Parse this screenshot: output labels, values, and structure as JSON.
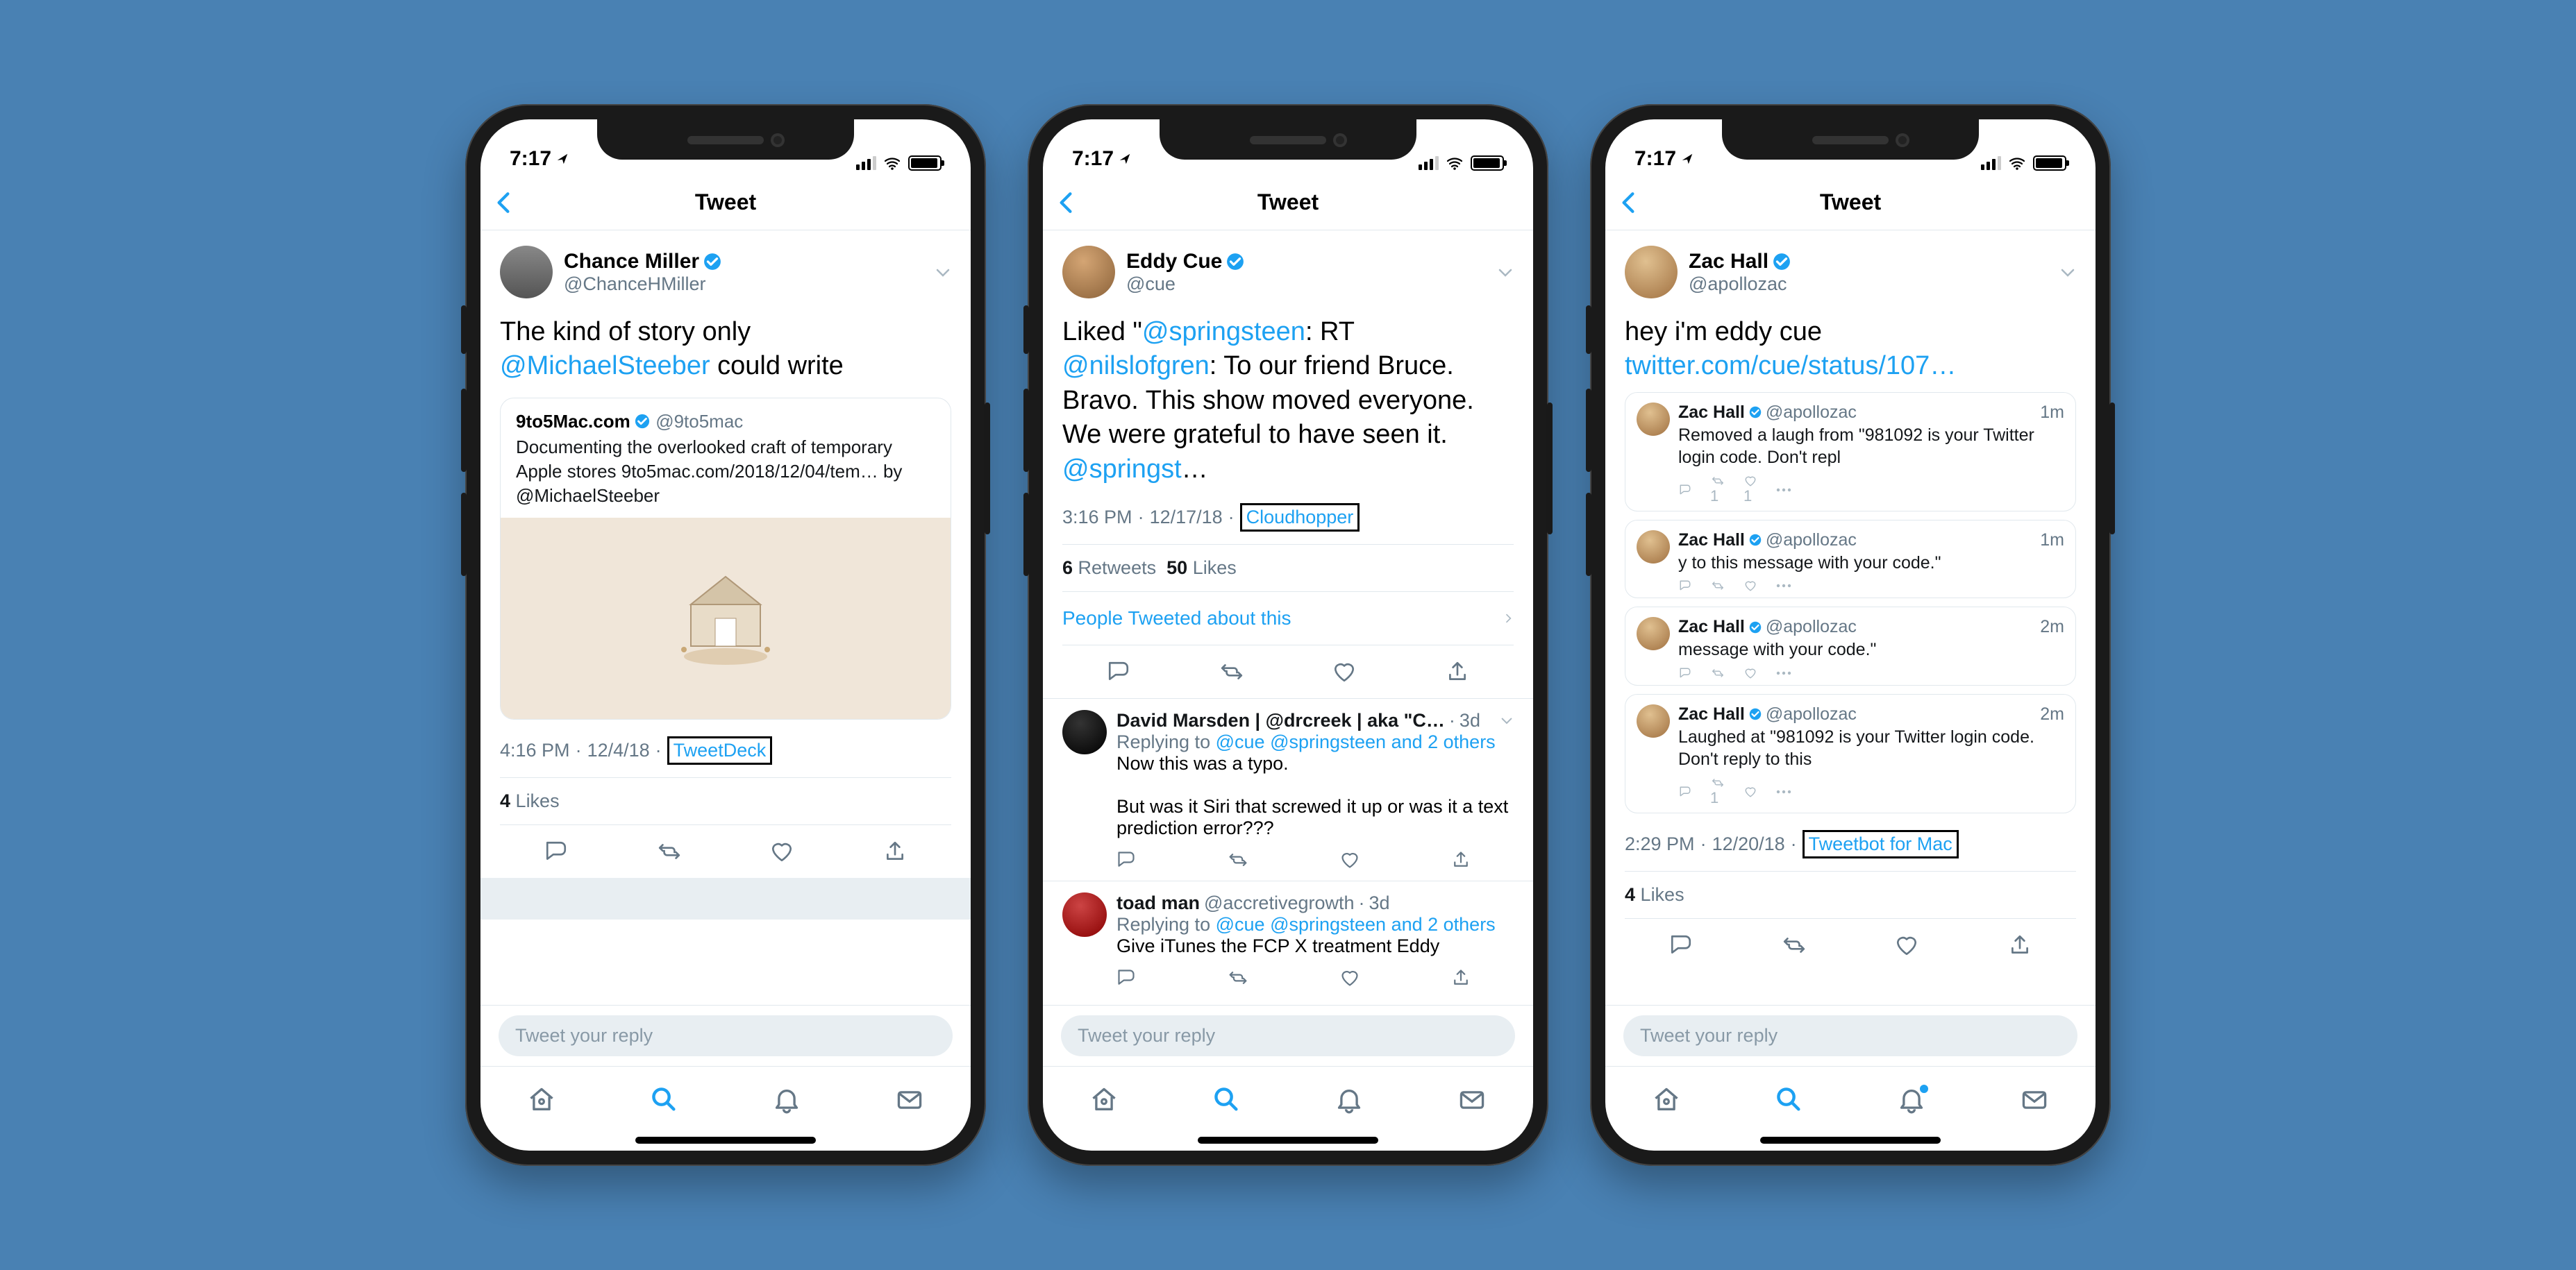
{
  "status": {
    "time": "7:17",
    "loc_icon": "location-arrow"
  },
  "header": {
    "title": "Tweet",
    "back": "‹"
  },
  "reply_placeholder": "Tweet your reply",
  "phone1": {
    "author": {
      "name": "Chance Miller",
      "handle": "@ChanceHMiller",
      "verified": true
    },
    "text_parts": [
      "The kind of story only ",
      "@MichaelSteeber",
      " could write"
    ],
    "quote": {
      "name": "9to5Mac.com",
      "handle": "@9to5mac",
      "verified": true,
      "text": "Documenting the overlooked craft of temporary Apple stores 9to5mac.com/2018/12/04/tem… by @MichaelSteeber"
    },
    "meta": {
      "time": "4:16 PM",
      "date": "12/4/18",
      "source": "TweetDeck"
    },
    "likes_line": {
      "count": "4",
      "label": "Likes"
    }
  },
  "phone2": {
    "author": {
      "name": "Eddy Cue",
      "handle": "@cue",
      "verified": true
    },
    "text_parts": [
      "Liked \"",
      "@springsteen",
      ": RT ",
      "@nilslofgren",
      ": To our friend Bruce.  Bravo. This show moved everyone.  We were grateful to have seen it. ",
      "@springst",
      "…"
    ],
    "meta": {
      "time": "3:16 PM",
      "date": "12/17/18",
      "source": "Cloudhopper"
    },
    "counts": {
      "rt": "6",
      "rt_label": "Retweets",
      "likes": "50",
      "likes_label": "Likes"
    },
    "ptat": "People Tweeted about this",
    "replies": [
      {
        "name": "David Marsden | @drcreek | aka \"C…",
        "age": "3d",
        "replying_to": [
          "@cue",
          "@springsteen",
          "and 2 others"
        ],
        "lines": [
          "Now this was a typo.",
          "",
          "But was it Siri that screwed it up or was it a text prediction error???"
        ]
      },
      {
        "name": "toad man",
        "handle": "@accretivegrowth",
        "age": "3d",
        "replying_to": [
          "@cue",
          "@springsteen",
          "and 2 others"
        ],
        "lines": [
          "Give iTunes the FCP X treatment Eddy"
        ]
      }
    ]
  },
  "phone3": {
    "author": {
      "name": "Zac Hall",
      "handle": "@apollozac",
      "verified": true
    },
    "text_parts": [
      "hey i'm eddy cue ",
      "twitter.com/cue/status/107…"
    ],
    "quotes": [
      {
        "name": "Zac Hall",
        "handle": "@apollozac",
        "age": "1m",
        "text": "Removed a laugh from \"981092 is your Twitter login code. Don't repl",
        "rt": "1",
        "like": "1"
      },
      {
        "name": "Zac Hall",
        "handle": "@apollozac",
        "age": "1m",
        "text": "y to this message with your code.\""
      },
      {
        "name": "Zac Hall",
        "handle": "@apollozac",
        "age": "2m",
        "text": "message with your code.\""
      },
      {
        "name": "Zac Hall",
        "handle": "@apollozac",
        "age": "2m",
        "text": "Laughed at \"981092 is your Twitter login code. Don't reply to this",
        "rt": "1"
      }
    ],
    "meta": {
      "time": "2:29 PM",
      "date": "12/20/18",
      "source": "Tweetbot for Mac"
    },
    "likes_line": {
      "count": "4",
      "label": "Likes"
    },
    "bell_dot": true
  }
}
